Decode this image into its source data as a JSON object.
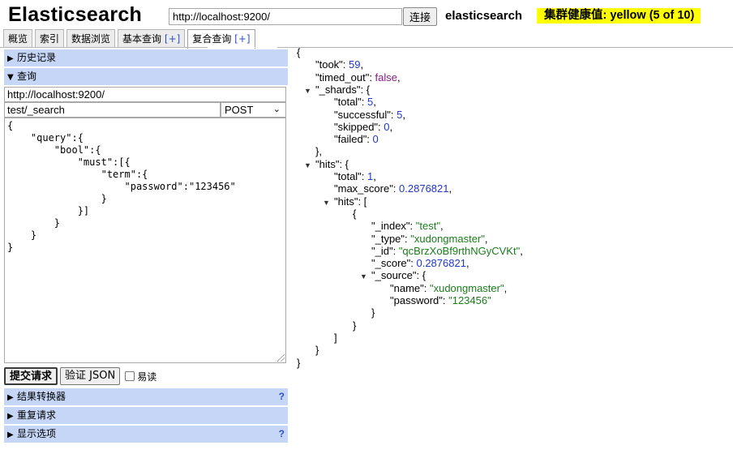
{
  "header": {
    "title": "Elasticsearch",
    "url": "http://localhost:9200/",
    "connect_label": "连接",
    "cluster_name": "elasticsearch",
    "health": "集群健康值: yellow (5 of 10)",
    "health_color": "#ffff00"
  },
  "tabs": [
    {
      "label": "概览"
    },
    {
      "label": "索引"
    },
    {
      "label": "数据浏览"
    },
    {
      "label": "基本查询",
      "plus": "[+]"
    },
    {
      "label": "复合查询",
      "plus": "[+]",
      "active": true
    }
  ],
  "left": {
    "history_label": "历史记录",
    "query_label": "查询",
    "server_url": "http://localhost:9200/",
    "path": "test/_search",
    "method": "POST",
    "body_lines": [
      "{",
      "    \"query\":{",
      "        \"bool\":{",
      "            \"must\":[{",
      "                \"term\":{",
      "                    \"password\":\"123456\"",
      "                }",
      "            }]",
      "        }",
      "    }",
      "}"
    ],
    "submit_label": "提交请求",
    "validate_label": "验证 JSON",
    "pretty_label": "易读",
    "transformer_label": "结果转换器",
    "repeat_label": "重复请求",
    "display_label": "显示选项",
    "help_mark": "?"
  },
  "result_lines": [
    {
      "indent": 0,
      "parts": [
        {
          "t": "{",
          "c": "k"
        }
      ]
    },
    {
      "indent": 1,
      "parts": [
        {
          "t": "\"took\": ",
          "c": "k"
        },
        {
          "t": "59",
          "c": "n"
        },
        {
          "t": ",",
          "c": "k"
        }
      ]
    },
    {
      "indent": 1,
      "parts": [
        {
          "t": "\"timed_out\": ",
          "c": "k"
        },
        {
          "t": "false",
          "c": "b"
        },
        {
          "t": ",",
          "c": "k"
        }
      ]
    },
    {
      "indent": 1,
      "fold": true,
      "parts": [
        {
          "t": "\"_shards\": {",
          "c": "k"
        }
      ]
    },
    {
      "indent": 2,
      "parts": [
        {
          "t": "\"total\": ",
          "c": "k"
        },
        {
          "t": "5",
          "c": "n"
        },
        {
          "t": ",",
          "c": "k"
        }
      ]
    },
    {
      "indent": 2,
      "parts": [
        {
          "t": "\"successful\": ",
          "c": "k"
        },
        {
          "t": "5",
          "c": "n"
        },
        {
          "t": ",",
          "c": "k"
        }
      ]
    },
    {
      "indent": 2,
      "parts": [
        {
          "t": "\"skipped\": ",
          "c": "k"
        },
        {
          "t": "0",
          "c": "n"
        },
        {
          "t": ",",
          "c": "k"
        }
      ]
    },
    {
      "indent": 2,
      "parts": [
        {
          "t": "\"failed\": ",
          "c": "k"
        },
        {
          "t": "0",
          "c": "n"
        }
      ]
    },
    {
      "indent": 1,
      "parts": [
        {
          "t": "},",
          "c": "k"
        }
      ]
    },
    {
      "indent": 1,
      "fold": true,
      "parts": [
        {
          "t": "\"hits\": {",
          "c": "k"
        }
      ]
    },
    {
      "indent": 2,
      "parts": [
        {
          "t": "\"total\": ",
          "c": "k"
        },
        {
          "t": "1",
          "c": "n"
        },
        {
          "t": ",",
          "c": "k"
        }
      ]
    },
    {
      "indent": 2,
      "parts": [
        {
          "t": "\"max_score\": ",
          "c": "k"
        },
        {
          "t": "0.2876821",
          "c": "n"
        },
        {
          "t": ",",
          "c": "k"
        }
      ]
    },
    {
      "indent": 2,
      "fold": true,
      "parts": [
        {
          "t": "\"hits\": [",
          "c": "k"
        }
      ]
    },
    {
      "indent": 3,
      "parts": [
        {
          "t": "{",
          "c": "k"
        }
      ]
    },
    {
      "indent": 4,
      "parts": [
        {
          "t": "\"_index\": ",
          "c": "k"
        },
        {
          "t": "\"test\"",
          "c": "s"
        },
        {
          "t": ",",
          "c": "k"
        }
      ]
    },
    {
      "indent": 4,
      "parts": [
        {
          "t": "\"_type\": ",
          "c": "k"
        },
        {
          "t": "\"xudongmaster\"",
          "c": "s"
        },
        {
          "t": ",",
          "c": "k"
        }
      ]
    },
    {
      "indent": 4,
      "parts": [
        {
          "t": "\"_id\": ",
          "c": "k"
        },
        {
          "t": "\"qcBrzXoBf9rthNGyCVKt\"",
          "c": "s"
        },
        {
          "t": ",",
          "c": "k"
        }
      ]
    },
    {
      "indent": 4,
      "parts": [
        {
          "t": "\"_score\": ",
          "c": "k"
        },
        {
          "t": "0.2876821",
          "c": "n"
        },
        {
          "t": ",",
          "c": "k"
        }
      ]
    },
    {
      "indent": 4,
      "fold": true,
      "parts": [
        {
          "t": "\"_source\": {",
          "c": "k"
        }
      ]
    },
    {
      "indent": 5,
      "parts": [
        {
          "t": "\"name\": ",
          "c": "k"
        },
        {
          "t": "\"xudongmaster\"",
          "c": "s"
        },
        {
          "t": ",",
          "c": "k"
        }
      ]
    },
    {
      "indent": 5,
      "parts": [
        {
          "t": "\"password\": ",
          "c": "k"
        },
        {
          "t": "\"123456\"",
          "c": "s"
        }
      ]
    },
    {
      "indent": 4,
      "parts": [
        {
          "t": "}",
          "c": "k"
        }
      ]
    },
    {
      "indent": 3,
      "parts": [
        {
          "t": "}",
          "c": "k"
        }
      ]
    },
    {
      "indent": 2,
      "parts": [
        {
          "t": "]",
          "c": "k"
        }
      ]
    },
    {
      "indent": 1,
      "parts": [
        {
          "t": "}",
          "c": "k"
        }
      ]
    },
    {
      "indent": 0,
      "parts": [
        {
          "t": "}",
          "c": "k"
        }
      ]
    }
  ]
}
